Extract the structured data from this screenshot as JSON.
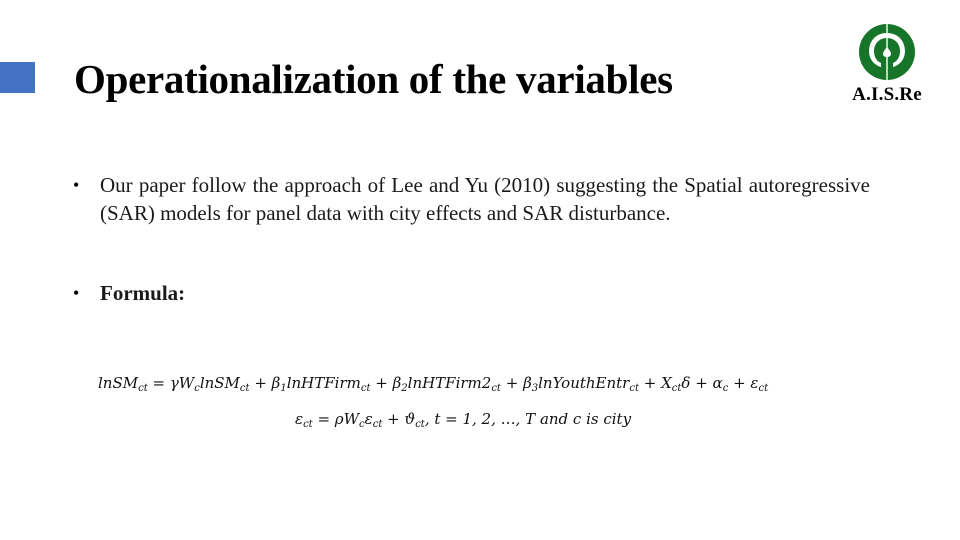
{
  "slide": {
    "title": "Operationalization of the variables",
    "accent_color": "#4472c4"
  },
  "logo": {
    "icon": "ais-re-logo-icon",
    "text": "A.I.S.Re",
    "color": "#17752a"
  },
  "bullets": [
    {
      "marker": "•",
      "text": "Our paper follow the approach of Lee and Yu (2010) suggesting the Spatial autoregressive (SAR) models for panel data with city effects and SAR disturbance."
    },
    {
      "marker": "•",
      "text": "Formula:"
    }
  ],
  "formula": {
    "line1": {
      "lhs": "lnSM",
      "lhs_sub": "ct",
      "eq": " = ",
      "t1a": "γW",
      "t1a_sub": "c",
      "t1b": "lnSM",
      "t1b_sub": "ct",
      "plus1": " + ",
      "t2a": "β",
      "t2a_sub": "1",
      "t2b": "lnHTFirm",
      "t2b_sub": "ct",
      "plus2": " + ",
      "t3a": "β",
      "t3a_sub": "2",
      "t3b": "lnHTFirm2",
      "t3b_sub": "ct",
      "plus3": " + ",
      "t4a": "β",
      "t4a_sub": "3",
      "t4b": "lnYouthEntr",
      "t4b_sub": "ct",
      "plus4": " + ",
      "t5a": "X",
      "t5a_sub": "ct",
      "t5b": "δ",
      "plus5": " + ",
      "t6": "α",
      "t6_sub": "c",
      "plus6": " + ",
      "t7": "ε",
      "t7_sub": "ct"
    },
    "line2": {
      "lhs": "ε",
      "lhs_sub": "ct",
      "eq": " = ",
      "t1a": "ρW",
      "t1a_sub": "c",
      "t1b": "ε",
      "t1b_sub": "ct",
      "plus1": " + ",
      "t2": "ϑ",
      "t2_sub": "ct",
      "rest": ", t = 1, 2, …, T and c is city"
    }
  }
}
